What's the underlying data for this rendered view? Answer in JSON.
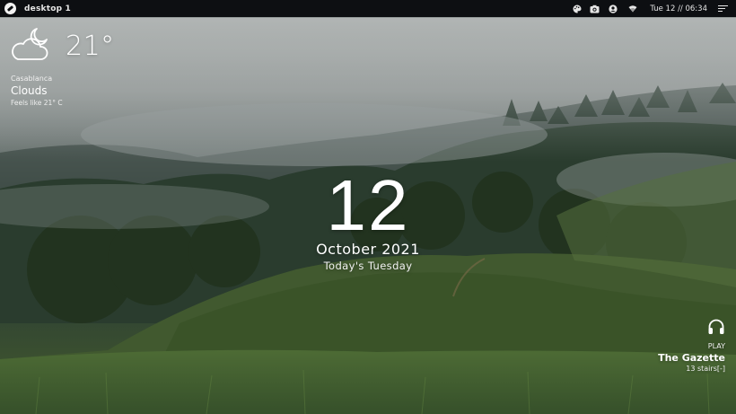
{
  "topbar": {
    "launcher_icon": "launcher-icon",
    "workspace_label": "desktop 1",
    "tray_icons": [
      "palette-icon",
      "camera-icon",
      "user-icon",
      "wifi-icon"
    ],
    "clock": "Tue 12 // 06:34",
    "menu_icon": "menu-icon",
    "background": "#0d0f12"
  },
  "weather": {
    "icon": "cloud-moon-icon",
    "temperature": "21°",
    "city": "Casablanca",
    "condition": "Clouds",
    "feels_like": "Feels like 21° C"
  },
  "date": {
    "day": "12",
    "month_year": "October 2021",
    "weekday_text": "Today's Tuesday"
  },
  "music": {
    "icon": "headphones-icon",
    "action": "PLAY",
    "track": "The Gazette",
    "artist": "13 stairs[-]"
  }
}
